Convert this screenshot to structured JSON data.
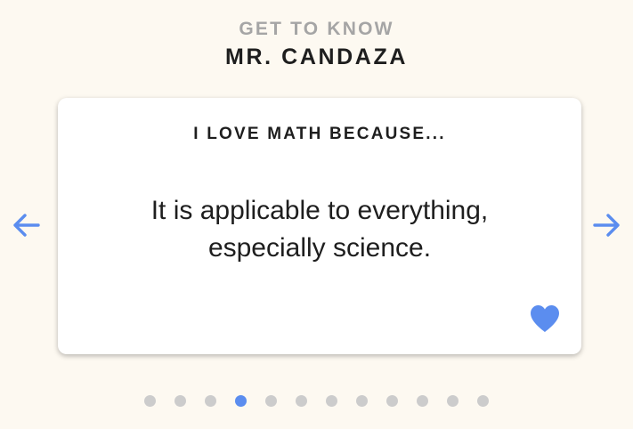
{
  "header": {
    "eyebrow": "GET TO KNOW",
    "title": "MR. CANDAZA"
  },
  "card": {
    "prompt": "I LOVE MATH BECAUSE...",
    "answer": "It is applicable to everything, especially science.",
    "heart_icon": "heart-icon"
  },
  "navigation": {
    "prev_icon": "arrow-left-icon",
    "next_icon": "arrow-right-icon"
  },
  "pagination": {
    "total": 12,
    "active_index": 3
  },
  "colors": {
    "background": "#fdf9f1",
    "accent": "#5b8def",
    "dot_inactive": "#cccccc",
    "eyebrow": "#a5a5a5",
    "text": "#1e1e1e"
  }
}
